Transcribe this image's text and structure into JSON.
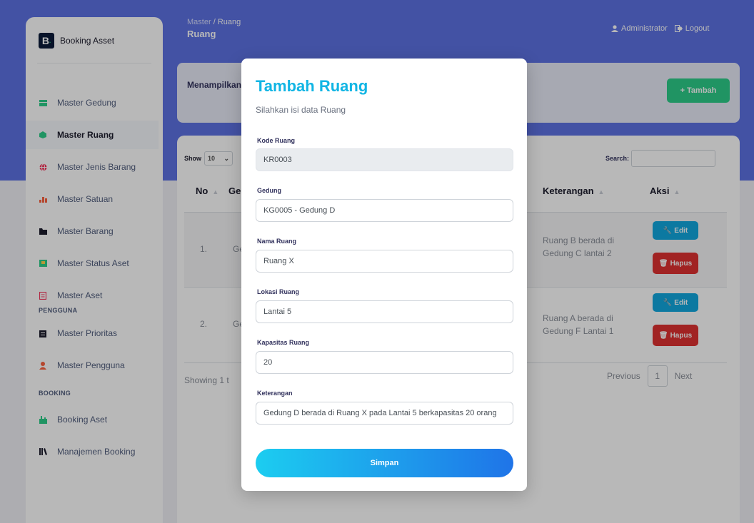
{
  "brand": {
    "logo": "B",
    "name": "Booking Asset"
  },
  "sidebar": {
    "items": [
      {
        "label": "Master Gedung",
        "icon": "building-icon",
        "color": "#2dce89"
      },
      {
        "label": "Master Ruang",
        "icon": "cube-icon",
        "color": "#2dce89"
      },
      {
        "label": "Master Jenis Barang",
        "icon": "globe-icon",
        "color": "#f5365c"
      },
      {
        "label": "Master Satuan",
        "icon": "bar-chart-icon",
        "color": "#fb6340"
      },
      {
        "label": "Master Barang",
        "icon": "folder-icon",
        "color": "#1d1d2d"
      },
      {
        "label": "Master Status Aset",
        "icon": "box-icon",
        "color": "#2dce89"
      },
      {
        "label": "Master Aset",
        "icon": "list-icon",
        "color": "#f5365c"
      }
    ],
    "heading_pengguna": "PENGGUNA",
    "pengguna_items": [
      {
        "label": "Master Prioritas",
        "icon": "clipboard-icon",
        "color": "#1d1d2d"
      },
      {
        "label": "Master Pengguna",
        "icon": "user-icon",
        "color": "#fb6340"
      }
    ],
    "heading_booking": "BOOKING",
    "booking_items": [
      {
        "label": "Booking Aset",
        "icon": "calendar-icon",
        "color": "#2dce89"
      },
      {
        "label": "Manajemen Booking",
        "icon": "library-icon",
        "color": "#1d1d2d"
      }
    ]
  },
  "header": {
    "crumb_root": "Master",
    "crumb_sep": "/",
    "crumb_current": "Ruang",
    "title": "Ruang",
    "user": "Administrator",
    "logout": "Logout"
  },
  "info": {
    "text": "Menampilkan",
    "add_button": "Tambah"
  },
  "table": {
    "show_label": "Show",
    "show_value": "10",
    "search_label": "Search:",
    "columns": [
      "No",
      "Ge",
      "Keterangan",
      "Aksi"
    ],
    "rows": [
      {
        "no": "1.",
        "ge": "Ge",
        "ket": "Ruang B berada di Gedung C lantai 2"
      },
      {
        "no": "2.",
        "ge": "Ge",
        "ket": "Ruang A berada di Gedung F Lantai 1"
      }
    ],
    "edit_label": "Edit",
    "hapus_label": "Hapus",
    "showing": "Showing 1 t",
    "previous": "Previous",
    "page": "1",
    "next": "Next"
  },
  "modal": {
    "title": "Tambah Ruang",
    "subtitle": "Silahkan isi data Ruang",
    "fields": [
      {
        "label": "Kode Ruang",
        "value": "KR0003",
        "readonly": true
      },
      {
        "label": "Gedung",
        "value": "KG0005 - Gedung D"
      },
      {
        "label": "Nama Ruang",
        "value": "Ruang X"
      },
      {
        "label": "Lokasi Ruang",
        "value": "Lantai 5"
      },
      {
        "label": "Kapasitas Ruang",
        "value": "20"
      },
      {
        "label": "Keterangan",
        "value": "Gedung D berada di Ruang X pada Lantai 5 berkapasitas 20 orang"
      }
    ],
    "submit": "Simpan"
  },
  "colors": {
    "primary": "#5e72e4",
    "success": "#2dce89",
    "info": "#11a8e0",
    "danger": "#e03131",
    "modal_title": "#11b5e4"
  }
}
